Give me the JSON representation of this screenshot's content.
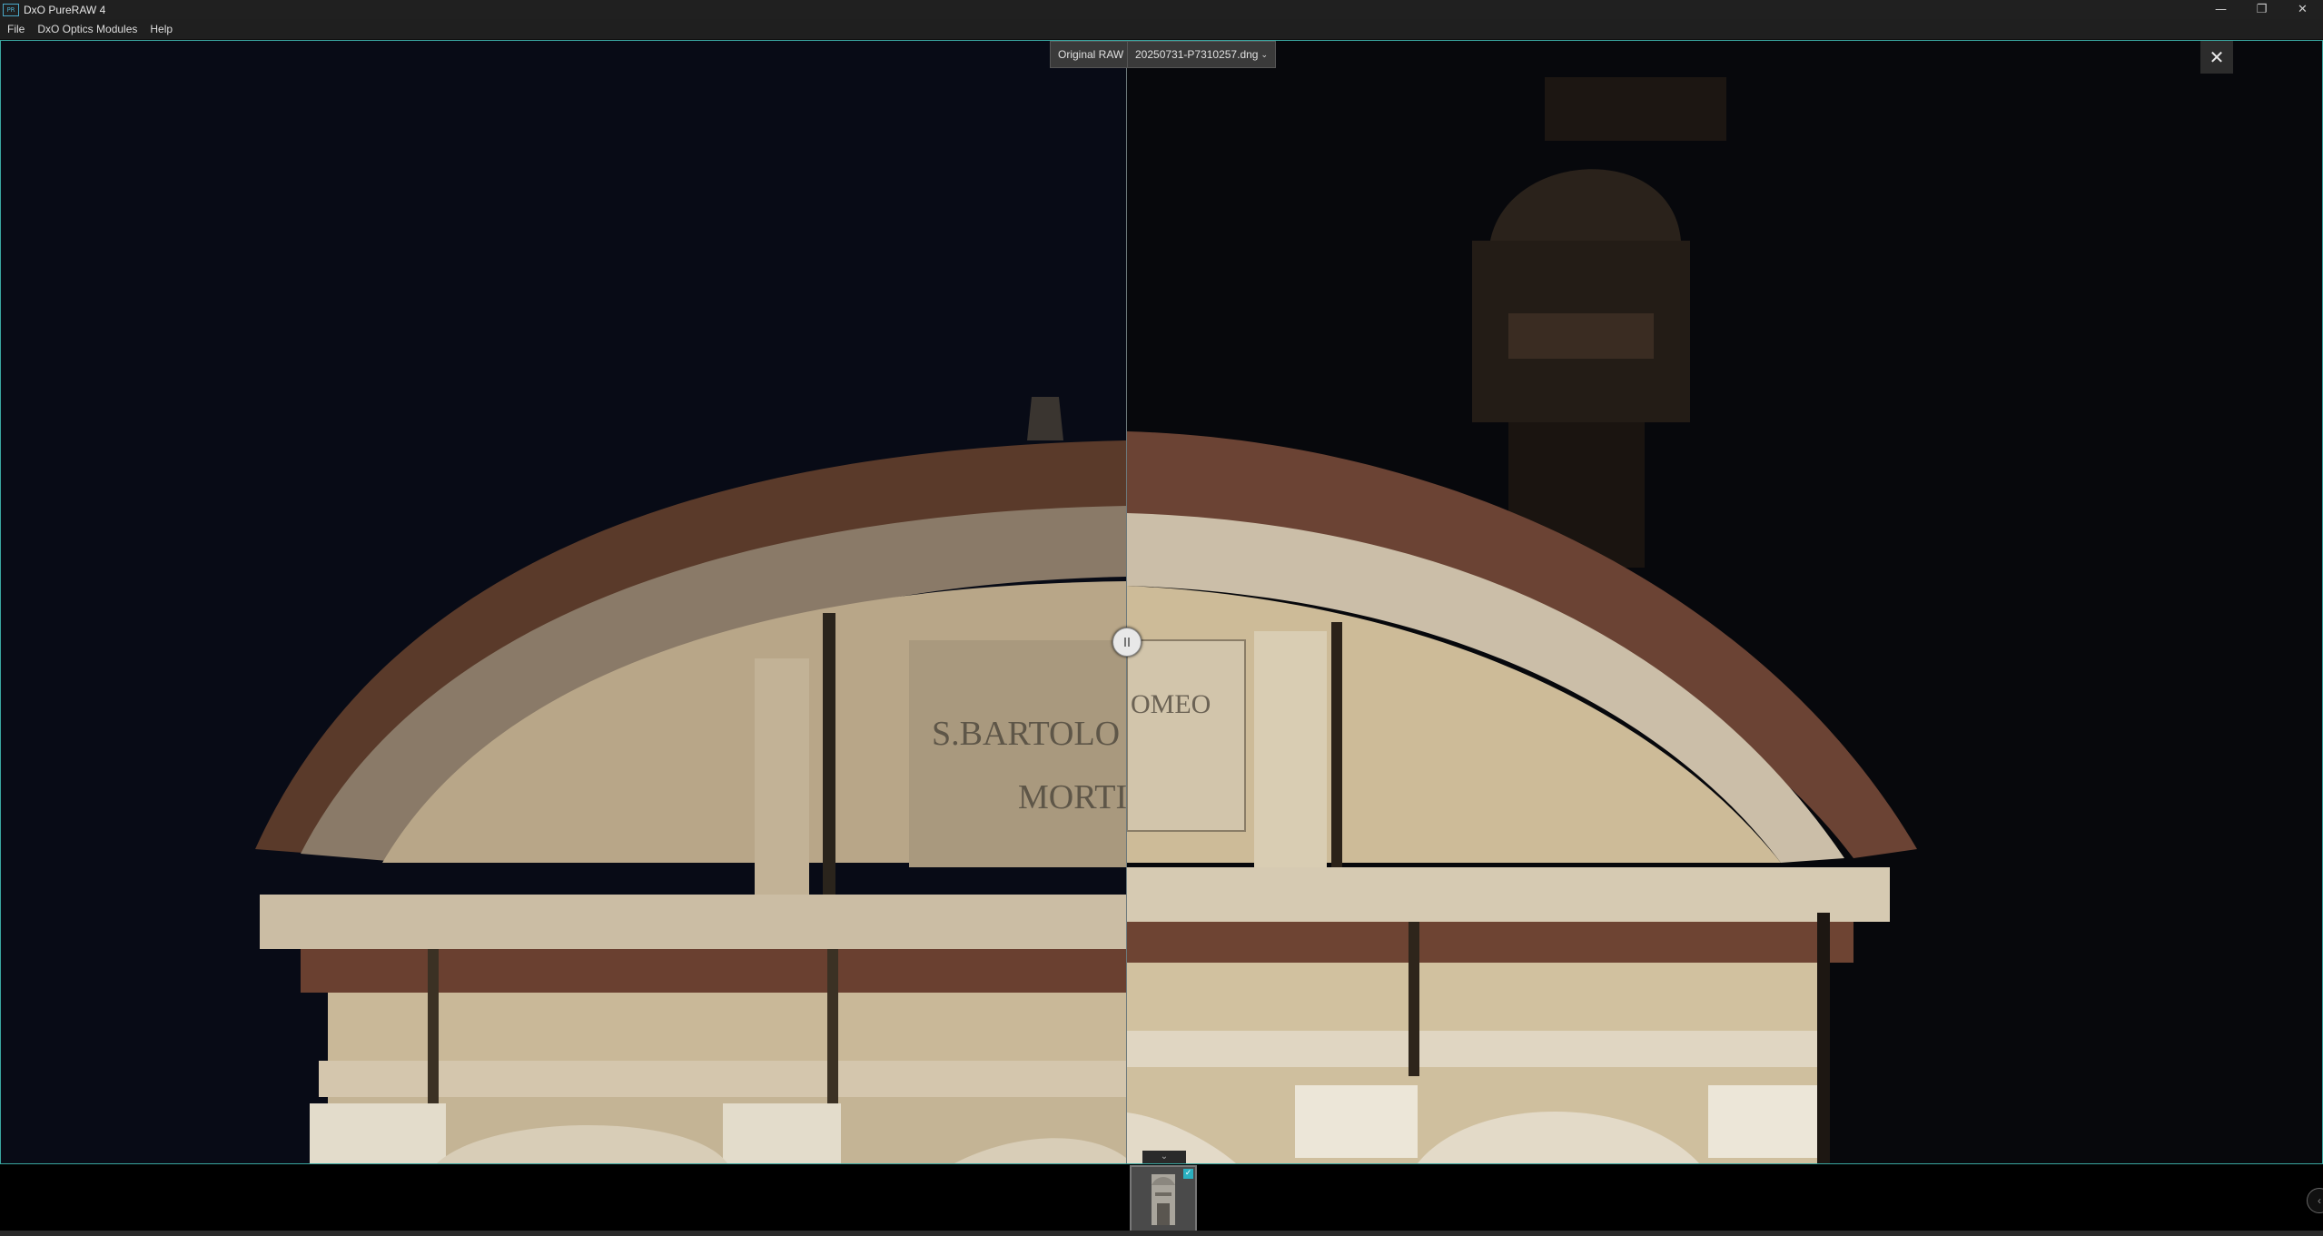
{
  "window": {
    "title": "DxO PureRAW 4",
    "icon_text": "PR"
  },
  "menu": {
    "items": [
      "File",
      "DxO Optics Modules",
      "Help"
    ]
  },
  "viewer": {
    "original_label": "Original RAW",
    "file_name": "20250731-P7310257.dng",
    "inscription_left_line1": "S.BARTOLO",
    "inscription_left_line2": "MORTI",
    "inscription_right": "OMEO"
  },
  "filmstrip": {
    "thumbnails": [
      {
        "selected": true,
        "checked": true
      }
    ]
  },
  "colors": {
    "accent": "#3aa6a0",
    "check": "#2ab0c0"
  }
}
